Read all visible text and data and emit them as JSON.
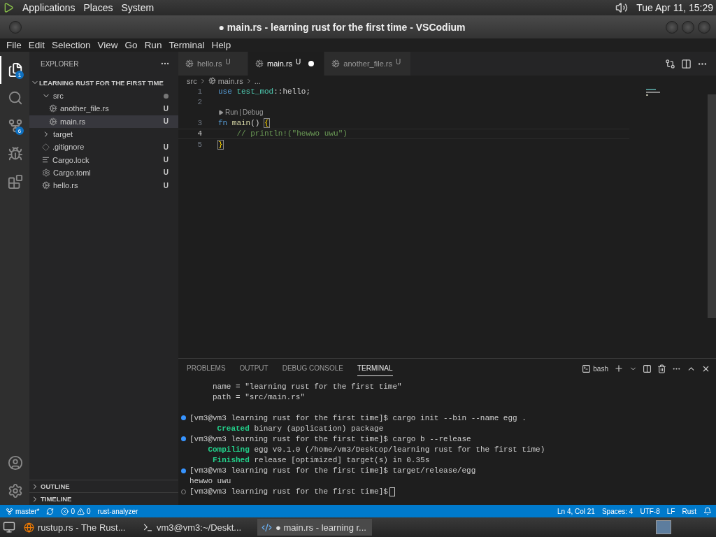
{
  "top_panel": {
    "menus": [
      "Applications",
      "Places",
      "System"
    ],
    "clock": "Tue Apr 11, 15:29"
  },
  "window": {
    "title": "● main.rs - learning rust for the first time - VSCodium"
  },
  "menu_bar": [
    "File",
    "Edit",
    "Selection",
    "View",
    "Go",
    "Run",
    "Terminal",
    "Help"
  ],
  "activity_bar": {
    "top": [
      {
        "kind": "files",
        "selected": true,
        "badge": "1"
      },
      {
        "kind": "search",
        "selected": false
      },
      {
        "kind": "scm",
        "selected": false,
        "badge": "6"
      },
      {
        "kind": "debug",
        "selected": false
      },
      {
        "kind": "extensions",
        "selected": false
      }
    ],
    "bottom": [
      {
        "kind": "account"
      },
      {
        "kind": "settings"
      }
    ]
  },
  "sidebar": {
    "title": "EXPLORER",
    "root": "LEARNING RUST FOR THE FIRST TIME",
    "tree": [
      {
        "label": "src",
        "kind": "folder",
        "expanded": true,
        "dot": true,
        "selected": false,
        "children": [
          {
            "label": "another_file.rs",
            "kind": "rust",
            "badge": "U",
            "selected": false
          },
          {
            "label": "main.rs",
            "kind": "rust",
            "badge": "U",
            "selected": true
          }
        ]
      },
      {
        "label": "target",
        "kind": "folder",
        "expanded": false,
        "selected": false
      },
      {
        "label": ".gitignore",
        "kind": "ignore",
        "badge": "U",
        "selected": false
      },
      {
        "label": "Cargo.lock",
        "kind": "lock",
        "badge": "U",
        "selected": false
      },
      {
        "label": "Cargo.toml",
        "kind": "config",
        "badge": "U",
        "selected": false
      },
      {
        "label": "hello.rs",
        "kind": "rust",
        "badge": "U",
        "selected": false
      }
    ],
    "sections": [
      "OUTLINE",
      "TIMELINE"
    ]
  },
  "tabs": [
    {
      "label": "hello.rs",
      "badge": "U",
      "selected": false,
      "modified": false
    },
    {
      "label": "main.rs",
      "badge": "U",
      "selected": true,
      "modified": true
    },
    {
      "label": "another_file.rs",
      "badge": "U",
      "selected": false,
      "modified": false
    }
  ],
  "breadcrumb": [
    "src",
    "main.rs",
    "..."
  ],
  "code": [
    {
      "kind": "line",
      "number": "1",
      "current": false,
      "tokens": [
        {
          "text": "use ",
          "kind": "keyword"
        },
        {
          "text": "test_mod",
          "kind": "module"
        },
        {
          "text": "::hello;",
          "kind": "plain"
        }
      ]
    },
    {
      "kind": "line",
      "number": "2",
      "current": false
    },
    {
      "kind": "lens",
      "actions": [
        "Run",
        "Debug"
      ],
      "separator": "|"
    },
    {
      "kind": "line",
      "number": "3",
      "current": false,
      "tokens": [
        {
          "text": "fn ",
          "kind": "keyword"
        },
        {
          "text": "main",
          "kind": "function"
        },
        {
          "text": "() ",
          "kind": "plain"
        },
        {
          "text": "{",
          "kind": "bracket"
        }
      ]
    },
    {
      "kind": "line",
      "number": "4",
      "current": true,
      "tokens": [
        {
          "text": "    // println!(\"hewwo uwu\")",
          "kind": "comment"
        }
      ]
    },
    {
      "kind": "line",
      "number": "5",
      "current": false,
      "tokens": [
        {
          "text": "}",
          "kind": "bracket"
        }
      ]
    }
  ],
  "panel": {
    "tabs": [
      {
        "label": "PROBLEMS",
        "selected": false
      },
      {
        "label": "OUTPUT",
        "selected": false
      },
      {
        "label": "DEBUG CONSOLE",
        "selected": false
      },
      {
        "label": "TERMINAL",
        "selected": true
      }
    ],
    "shell": "bash",
    "terminal": [
      {
        "text": "     name = \"learning rust for the first time\""
      },
      {
        "text": "     path = \"src/main.rs\""
      },
      {
        "finished": true,
        "gap_before": true,
        "text": "[vm3@vm3 learning rust for the first time]$ cargo init --bin --name egg ."
      },
      {
        "label": "      Created",
        "text": " binary (application) package"
      },
      {
        "finished": true,
        "text": "[vm3@vm3 learning rust for the first time]$ cargo b --release"
      },
      {
        "label": "    Compiling",
        "text": " egg v0.1.0 (/home/vm3/Desktop/learning rust for the first time)"
      },
      {
        "label": "     Finished",
        "text": " release [optimized] target(s) in 0.35s"
      },
      {
        "finished": true,
        "text": "[vm3@vm3 learning rust for the first time]$ target/release/egg"
      },
      {
        "text": "hewwo uwu"
      },
      {
        "finished": false,
        "text": "[vm3@vm3 learning rust for the first time]$ ",
        "cursor": true
      }
    ]
  },
  "status_bar": {
    "branch": "master*",
    "errors": "0",
    "warnings": "0",
    "extension": "rust-analyzer",
    "right": [
      "Ln 4, Col 21",
      "Spaces: 4",
      "UTF-8",
      "LF",
      "Rust"
    ]
  },
  "taskbar": [
    {
      "label": "rustup.rs - The Rust...",
      "kind": "browser",
      "selected": false
    },
    {
      "label": "vm3@vm3:~/Deskt...",
      "kind": "terminal",
      "selected": false
    },
    {
      "label": "● main.rs - learning r...",
      "kind": "editor",
      "selected": true
    }
  ]
}
